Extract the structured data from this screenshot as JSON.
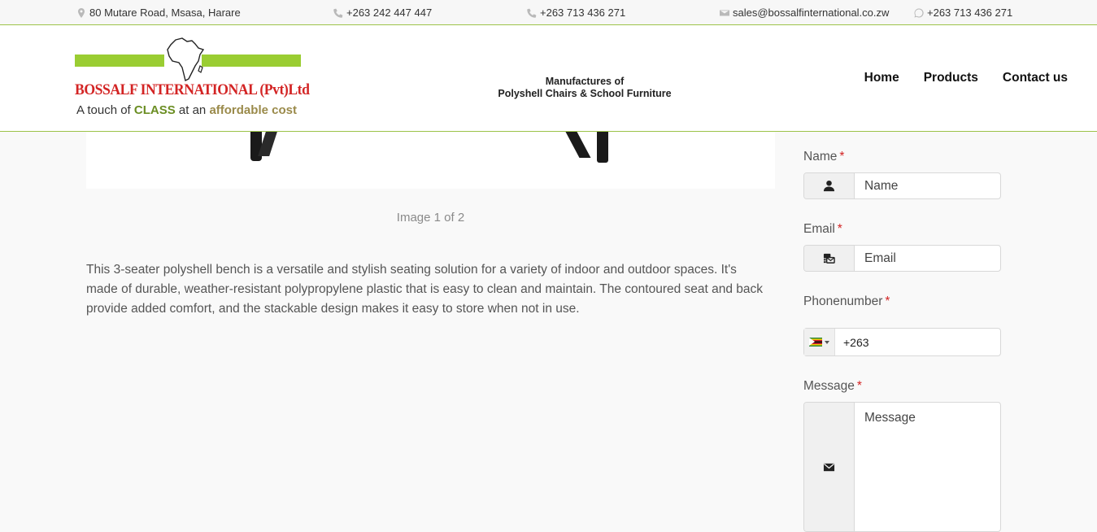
{
  "topbar": {
    "address": "80 Mutare Road, Msasa, Harare",
    "phone1": "+263 242 447 447",
    "phone2": "+263 713 436 271",
    "email": "sales@bossalfinternational.co.zw",
    "whatsapp": "+263 713 436 271"
  },
  "header": {
    "brand_name": "BOSSALF INTERNATIONAL (Pvt)Ltd",
    "slogan_part1": "A touch of ",
    "slogan_class": "CLASS",
    "slogan_part2": " at an ",
    "slogan_affordable": "affordable cost",
    "tagline_line1": "Manufactures of",
    "tagline_line2": "Polyshell Chairs & School Furniture"
  },
  "nav": {
    "home": "Home",
    "products": "Products",
    "contact": "Contact us"
  },
  "product": {
    "image_caption": "Image 1 of 2",
    "description": "This 3-seater polyshell bench is a versatile and stylish seating solution for a variety of indoor and outdoor spaces. It's made of durable, weather-resistant polypropylene plastic that is easy to clean and maintain. The contoured seat and back provide added comfort, and the stackable design makes it easy to store when not in use."
  },
  "form": {
    "name_label": "Name",
    "name_placeholder": "Name",
    "email_label": "Email",
    "email_placeholder": "Email",
    "phone_label": "Phonenumber",
    "phone_value": "+263",
    "message_label": "Message",
    "message_placeholder": "Message",
    "required_mark": "*"
  },
  "colors": {
    "brand_green": "#9acd32",
    "brand_red": "#d32424",
    "divider_green": "#9cc34a"
  },
  "icons": [
    "map-marker-icon",
    "phone-icon",
    "mobile-icon",
    "envelope-icon",
    "whatsapp-icon",
    "user-icon",
    "mail-bulk-icon",
    "envelope-icon",
    "zimbabwe-flag-icon"
  ]
}
